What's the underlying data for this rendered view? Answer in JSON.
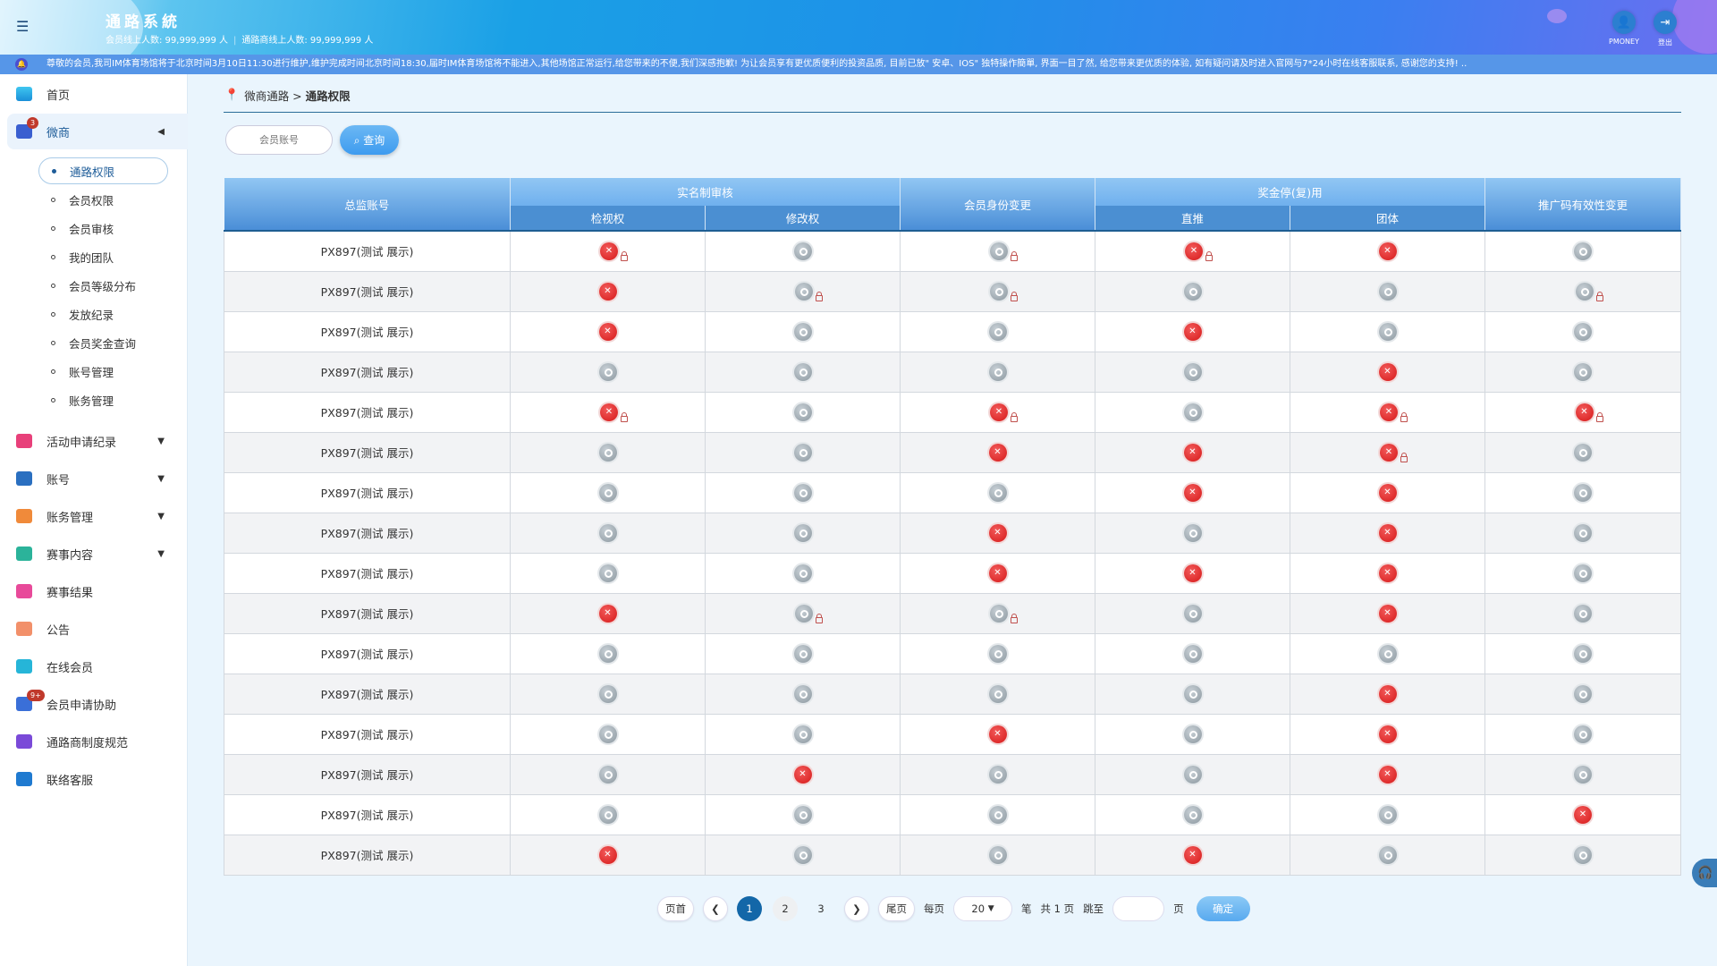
{
  "header": {
    "menu_icon": "hamburger-icon",
    "title": "通路系統",
    "member_online_label": "会员线上人数: 99,999,999 人",
    "channel_online_label": "通路商线上人数: 99,999,999 人",
    "user_label": "PMONEY",
    "logout_label": "登出"
  },
  "marquee": {
    "text": "尊敬的会员,我司IM体育场馆将于北京时间3月10日11:30进行维护,维护完成时间北京时间18:30,届时IM体育场馆将不能进入,其他场馆正常运行,给您带来的不便,我们深感抱歉! 为让会员享有更优质便利的投资品质, 目前已放\" 安卓、IOS\" 独特操作簡單, 界面一目了然, 给您带来更优质的体验, 如有疑问请及时进入官网与7*24小时在线客服联系, 感谢您的支持! .."
  },
  "sidebar": {
    "home": "首页",
    "weishang": {
      "label": "微商",
      "badge": "3"
    },
    "sub_items": [
      "通路权限",
      "会员权限",
      "会员审核",
      "我的团队",
      "会员等级分布",
      "发放纪录",
      "会员奖金查询",
      "账号管理",
      "账务管理"
    ],
    "items": [
      {
        "label": "活动申请纪录",
        "caret": true,
        "color": "#e8407a"
      },
      {
        "label": "账号",
        "caret": true,
        "color": "#2a6fc0"
      },
      {
        "label": "账务管理",
        "caret": true,
        "color": "#f08a3a"
      },
      {
        "label": "赛事内容",
        "caret": true,
        "color": "#2bb39a"
      },
      {
        "label": "赛事结果",
        "caret": false,
        "color": "#e84a9a"
      },
      {
        "label": "公告",
        "caret": false,
        "color": "#f2906a"
      },
      {
        "label": "在线会员",
        "caret": false,
        "color": "#26b5d8"
      },
      {
        "label": "会员申请协助",
        "caret": false,
        "color": "#3a6fd8",
        "badge": "9+"
      },
      {
        "label": "通路商制度规范",
        "caret": false,
        "color": "#7a4ad8"
      },
      {
        "label": "联络客服",
        "caret": false,
        "color": "#1f7ad0"
      }
    ]
  },
  "breadcrumb": {
    "parent": "微商通路 >",
    "current": "通路权限"
  },
  "search": {
    "placeholder": "会员账号",
    "button": "查询"
  },
  "table": {
    "headers": {
      "account": "总监账号",
      "realname": "实名制审核",
      "view": "检视权",
      "edit": "修改权",
      "identity": "会员身份变更",
      "bonus": "奖金停(复)用",
      "direct": "直推",
      "group": "团体",
      "promo": "推广码有效性变更"
    },
    "rows": [
      {
        "account": "PX897(测试 展示)",
        "cells": [
          "xL",
          "o",
          "oL",
          "xL",
          "x",
          "o"
        ]
      },
      {
        "account": "PX897(测试 展示)",
        "cells": [
          "x",
          "oL",
          "oL",
          "o",
          "o",
          "oL"
        ]
      },
      {
        "account": "PX897(测试 展示)",
        "cells": [
          "x",
          "o",
          "o",
          "x",
          "o",
          "o"
        ]
      },
      {
        "account": "PX897(测试 展示)",
        "cells": [
          "o",
          "o",
          "o",
          "o",
          "x",
          "o"
        ]
      },
      {
        "account": "PX897(测试 展示)",
        "cells": [
          "xL",
          "o",
          "xL",
          "o",
          "xL",
          "xL"
        ]
      },
      {
        "account": "PX897(测试 展示)",
        "cells": [
          "o",
          "o",
          "x",
          "x",
          "xL",
          "o"
        ]
      },
      {
        "account": "PX897(测试 展示)",
        "cells": [
          "o",
          "o",
          "o",
          "x",
          "x",
          "o"
        ]
      },
      {
        "account": "PX897(测试 展示)",
        "cells": [
          "o",
          "o",
          "x",
          "o",
          "x",
          "o"
        ]
      },
      {
        "account": "PX897(测试 展示)",
        "cells": [
          "o",
          "o",
          "x",
          "x",
          "x",
          "o"
        ]
      },
      {
        "account": "PX897(测试 展示)",
        "cells": [
          "x",
          "oL",
          "oL",
          "o",
          "x",
          "o"
        ]
      },
      {
        "account": "PX897(测试 展示)",
        "cells": [
          "o",
          "o",
          "o",
          "o",
          "o",
          "o"
        ]
      },
      {
        "account": "PX897(测试 展示)",
        "cells": [
          "o",
          "o",
          "o",
          "o",
          "x",
          "o"
        ]
      },
      {
        "account": "PX897(测试 展示)",
        "cells": [
          "o",
          "o",
          "x",
          "o",
          "x",
          "o"
        ]
      },
      {
        "account": "PX897(测试 展示)",
        "cells": [
          "o",
          "x",
          "o",
          "o",
          "x",
          "o"
        ]
      },
      {
        "account": "PX897(测试 展示)",
        "cells": [
          "o",
          "o",
          "o",
          "o",
          "o",
          "x"
        ]
      },
      {
        "account": "PX897(测试 展示)",
        "cells": [
          "x",
          "o",
          "o",
          "x",
          "o",
          "o"
        ]
      }
    ]
  },
  "pagination": {
    "first": "页首",
    "last": "尾页",
    "pages": [
      "1",
      "2",
      "3"
    ],
    "current_page": "1",
    "per_page_label": "每页",
    "per_page": "20",
    "unit": "笔",
    "total": "共 1 页",
    "jump_label": "跳至",
    "page_suffix": "页",
    "confirm": "确定"
  }
}
